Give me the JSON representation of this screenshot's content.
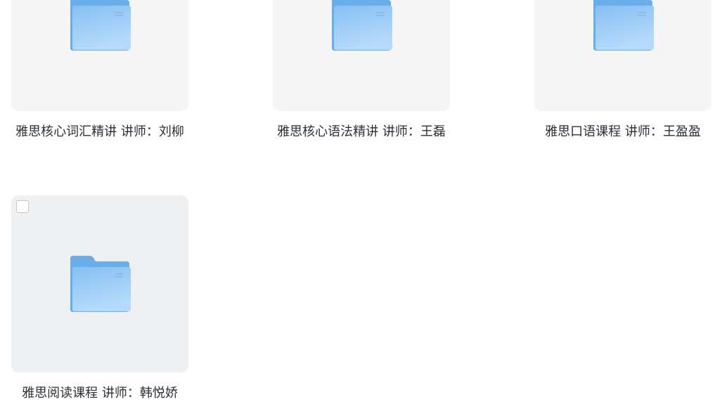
{
  "folders": [
    {
      "name": "雅思核心词汇精讲 讲师：刘柳",
      "icon": "folder-icon"
    },
    {
      "name": "雅思核心语法精讲 讲师：王磊",
      "icon": "folder-icon"
    },
    {
      "name": "雅思口语课程 讲师：王盈盈",
      "icon": "folder-icon"
    },
    {
      "name": "雅思阅读课程 讲师：韩悦娇",
      "icon": "folder-icon",
      "checkbox_checked": false
    }
  ],
  "colors": {
    "folder_back": "#6aaee9",
    "folder_front_top": "#8ec6f5",
    "folder_front_bottom": "#b4d9fb",
    "card_bg": "#f5f5f6",
    "card_hover_bg": "#eff0f2",
    "text": "#2b2f36"
  }
}
